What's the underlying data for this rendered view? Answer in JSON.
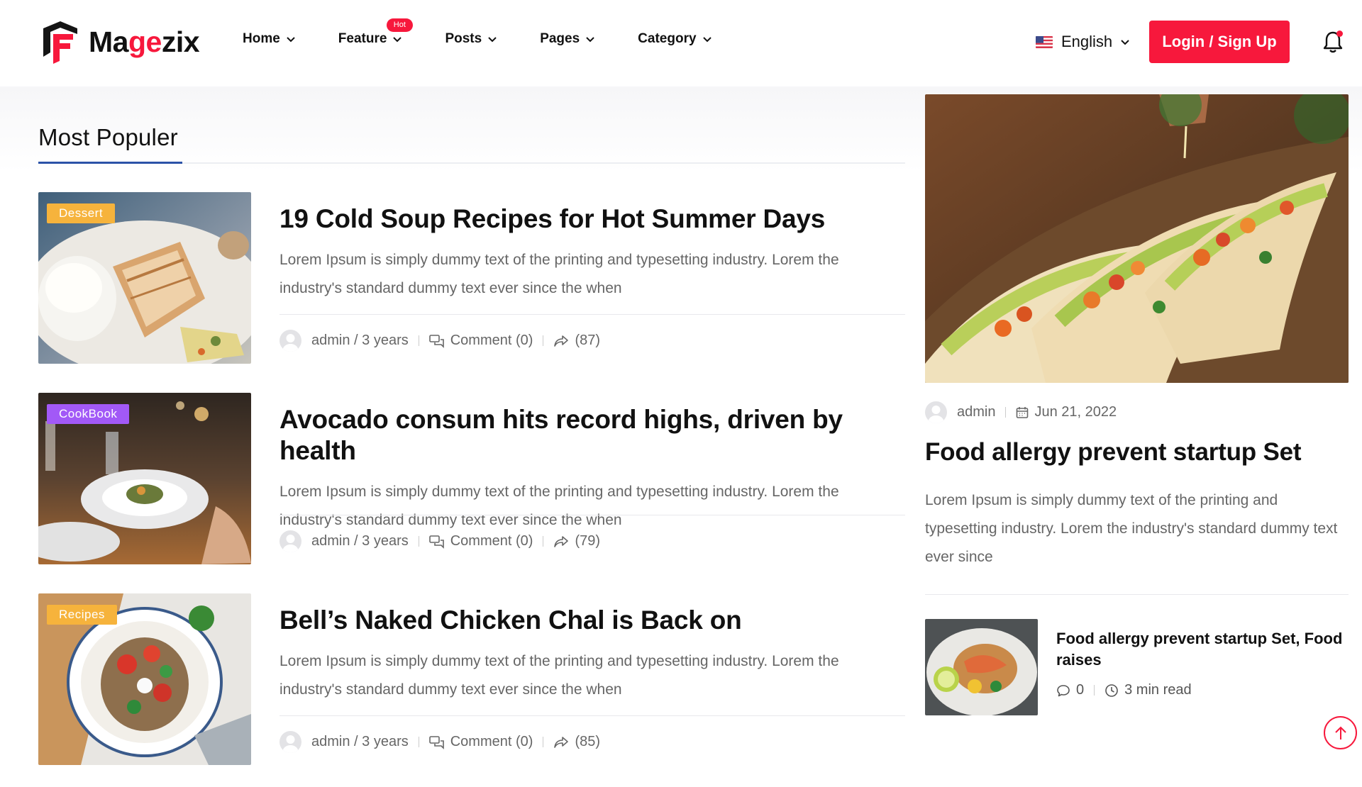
{
  "brand": {
    "name_part1": "Ma",
    "name_accent": "ge",
    "name_part2": "zix",
    "accent_color": "#f7183c"
  },
  "nav": {
    "items": [
      {
        "label": "Home"
      },
      {
        "label": "Feature",
        "badge": "Hot"
      },
      {
        "label": "Posts"
      },
      {
        "label": "Pages"
      },
      {
        "label": "Category"
      }
    ]
  },
  "language": {
    "label": "English",
    "flag_icon": "us-flag-icon"
  },
  "auth": {
    "login_label": "Login / Sign Up"
  },
  "section": {
    "title": "Most Populer"
  },
  "posts": [
    {
      "category": "Dessert",
      "category_color": "#f6b33c",
      "title": "19 Cold Soup Recipes for Hot Summer Days",
      "excerpt": "Lorem Ipsum is simply dummy text of the printing and typesetting industry. Lorem the industry's standard dummy text ever since the when",
      "author": "admin / 3 years",
      "comments": "Comment (0)",
      "shares": "(87)"
    },
    {
      "category": "CookBook",
      "category_color": "#a259f7",
      "title": "Avocado consum hits record highs, driven by health",
      "excerpt": "Lorem Ipsum is simply dummy text of the printing and typesetting industry. Lorem the industry's standard dummy text ever since the when",
      "author": "admin / 3 years",
      "comments": "Comment (0)",
      "shares": "(79)"
    },
    {
      "category": "Recipes",
      "category_color": "#f6b33c",
      "title": "Bell’s Naked Chicken Chal is Back on",
      "excerpt": "Lorem Ipsum is simply dummy text of the printing and typesetting industry. Lorem the industry's standard dummy text ever since the when",
      "author": "admin / 3 years",
      "comments": "Comment (0)",
      "shares": "(85)"
    }
  ],
  "featured": {
    "author": "admin",
    "date": "Jun 21, 2022",
    "title": "Food allergy prevent startup Set",
    "excerpt": "Lorem Ipsum is simply dummy text of the printing and typesetting industry. Lorem the industry's standard dummy text ever since"
  },
  "mini_post": {
    "title": "Food allergy prevent startup Set, Food raises",
    "comments": "0",
    "read_time": "3 min read"
  }
}
